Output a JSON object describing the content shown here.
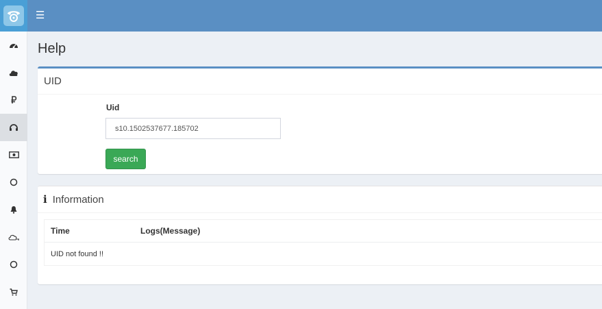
{
  "header": {
    "logo_icon": "telephone-icon",
    "menu_icon": "hamburger-icon",
    "bar_color": "#5a8fc3"
  },
  "sidebar": {
    "items": [
      {
        "icon": "dashboard-icon",
        "active": false
      },
      {
        "icon": "cloud-icon",
        "active": false
      },
      {
        "icon": "ruble-icon",
        "active": false
      },
      {
        "icon": "headset-icon",
        "active": true
      },
      {
        "icon": "money-icon",
        "active": false
      },
      {
        "icon": "circle-icon",
        "active": false
      },
      {
        "icon": "bell-icon",
        "active": false
      },
      {
        "icon": "cloud-key-icon",
        "active": false
      },
      {
        "icon": "circle-icon",
        "active": false
      },
      {
        "icon": "cart-icon",
        "active": false
      }
    ]
  },
  "page": {
    "title": "Help"
  },
  "uid_box": {
    "title": "UID",
    "field_label": "Uid",
    "field_value": "s10.1502537677.185702",
    "search_label": "search"
  },
  "info_box": {
    "title": "Information",
    "columns": [
      "Time",
      "Logs(Message)"
    ],
    "rows": [
      {
        "message": "UID not found !!"
      }
    ]
  }
}
